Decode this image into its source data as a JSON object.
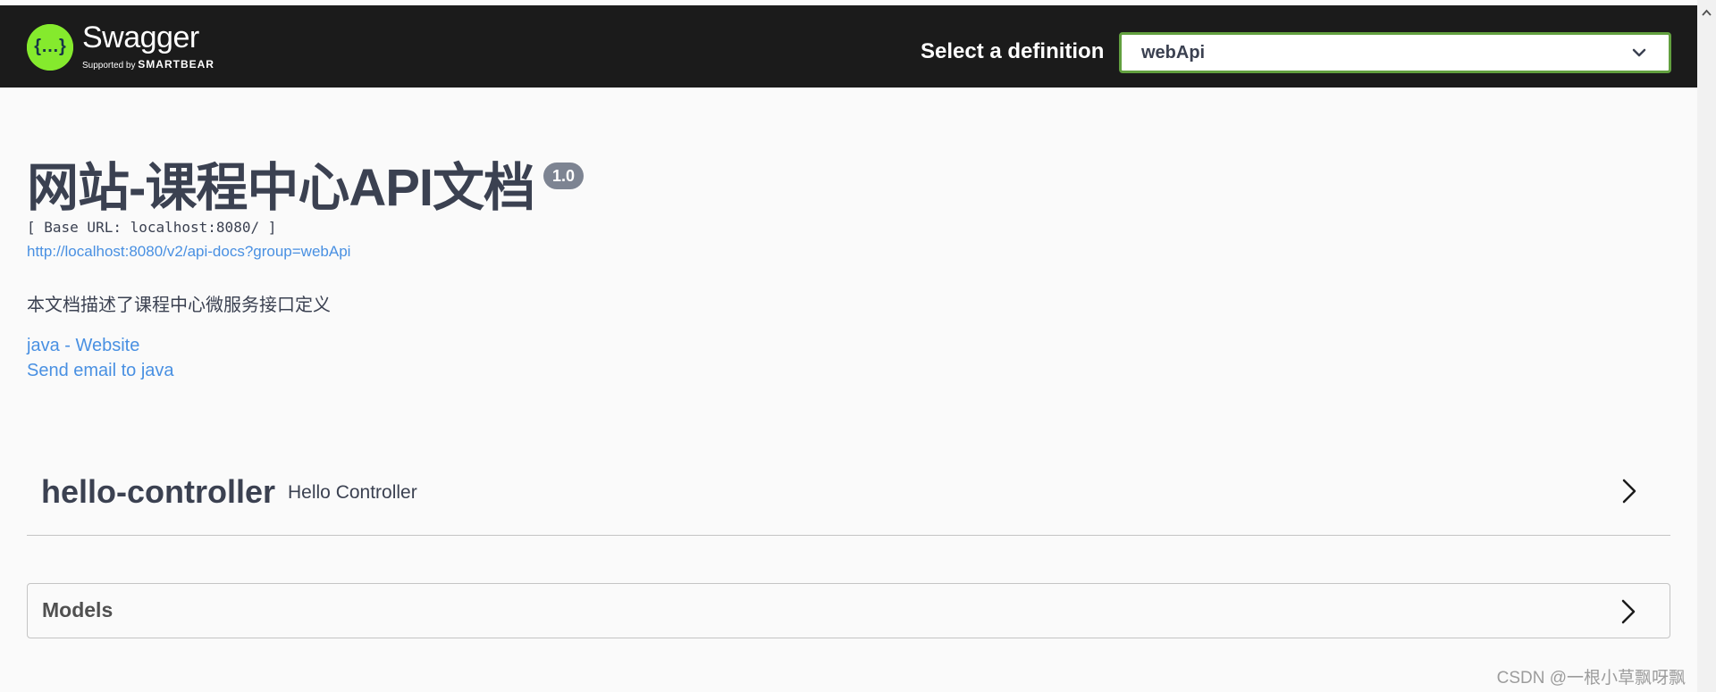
{
  "header": {
    "logo_title": "Swagger",
    "logo_sub_prefix": "Supported by",
    "logo_sub_brand": "SMARTBEAR",
    "definition_label": "Select a definition",
    "definition_value": "webApi"
  },
  "info": {
    "title": "网站-课程中心API文档",
    "version": "1.0",
    "base_url": "[ Base URL: localhost:8080/ ]",
    "docs_url": "http://localhost:8080/v2/api-docs?group=webApi",
    "description": "本文档描述了课程中心微服务接口定义",
    "website_link": "java - Website",
    "email_link": "Send email to java"
  },
  "tags": [
    {
      "name": "hello-controller",
      "description": "Hello Controller"
    }
  ],
  "models": {
    "title": "Models"
  },
  "watermark": "CSDN @一根小草飘呀飘",
  "colors": {
    "topbar": "#1b1b1b",
    "logo_green": "#85ea2d",
    "select_border": "#62a03f",
    "link": "#4990e2",
    "text": "#3b4151",
    "badge": "#7d8492"
  },
  "icons": {
    "logo": "swagger-logo-icon",
    "select": "chevron-down-icon",
    "expand": "chevron-right-icon"
  }
}
